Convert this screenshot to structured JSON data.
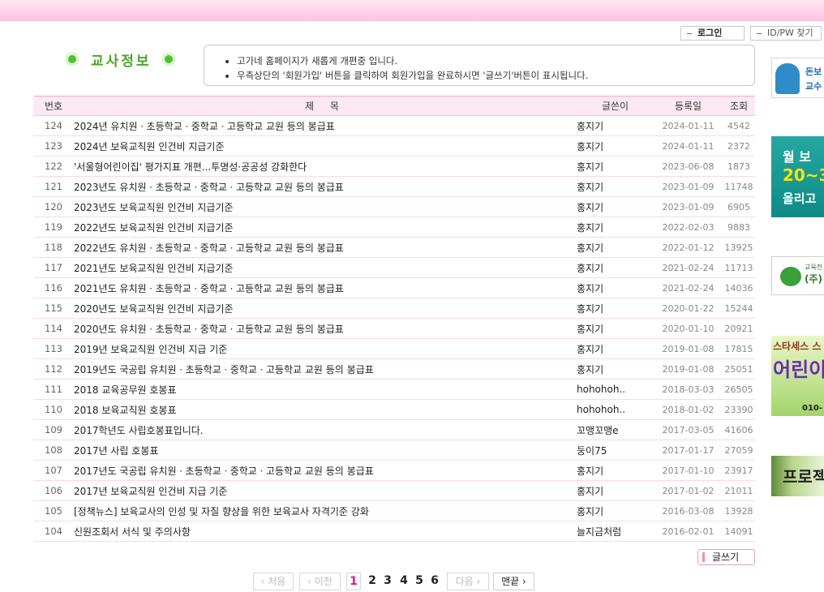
{
  "header": {
    "login_label": "로그인",
    "idpw_label": "ID/PW 찾기"
  },
  "section": {
    "title": "교사정보"
  },
  "notice": {
    "lines": [
      "고가네 홈페이지가 새롭게 개편중 입니다.",
      "우측상단의 '회원가입' 버튼을 클릭하여 회원가입을 완료하시면 '글쓰기'버튼이 표시됩니다."
    ]
  },
  "board": {
    "columns": [
      "번호",
      "제 목",
      "글쓴이",
      "등록일",
      "조회"
    ],
    "rows": [
      {
        "no": "124",
        "title": "2024년 유치원ㆍ초등학교ㆍ중학교ㆍ고등학교 교원 등의 봉급표",
        "author": "홍지기",
        "date": "2024-01-11",
        "views": "4542"
      },
      {
        "no": "123",
        "title": "2024년 보육교직원 인건비 지급기준",
        "author": "홍지기",
        "date": "2024-01-11",
        "views": "2372"
      },
      {
        "no": "122",
        "title": "'서울형어린이집' 평가지표 개편...투명성·공공성 강화한다",
        "author": "홍지기",
        "date": "2023-06-08",
        "views": "1873"
      },
      {
        "no": "121",
        "title": "2023년도 유치원ㆍ초등학교ㆍ중학교ㆍ고등학교 교원 등의 봉급표",
        "author": "홍지기",
        "date": "2023-01-09",
        "views": "11748"
      },
      {
        "no": "120",
        "title": "2023년도 보육교직원 인건비 지급기준",
        "author": "홍지기",
        "date": "2023-01-09",
        "views": "6905"
      },
      {
        "no": "119",
        "title": "2022년도 보육교직원 인건비 지급기준",
        "author": "홍지기",
        "date": "2022-02-03",
        "views": "9883"
      },
      {
        "no": "118",
        "title": "2022년도 유치원ㆍ초등학교ㆍ중학교ㆍ고등학교 교원 등의 봉급표",
        "author": "홍지기",
        "date": "2022-01-12",
        "views": "13925"
      },
      {
        "no": "117",
        "title": "2021년도 보육교직원 인건비 지급기준",
        "author": "홍지기",
        "date": "2021-02-24",
        "views": "11713"
      },
      {
        "no": "116",
        "title": "2021년도 유치원ㆍ초등학교ㆍ중학교ㆍ고등학교 교원 등의 봉급표",
        "author": "홍지기",
        "date": "2021-02-24",
        "views": "14036"
      },
      {
        "no": "115",
        "title": "2020년도 보육교직원 인건비 지급기준",
        "author": "홍지기",
        "date": "2020-01-22",
        "views": "15244"
      },
      {
        "no": "114",
        "title": "2020년도 유치원ㆍ초등학교ㆍ중학교ㆍ고등학교 교원 등의 봉급표",
        "author": "홍지기",
        "date": "2020-01-10",
        "views": "20921"
      },
      {
        "no": "113",
        "title": "2019년 보육교직원 인건비 지급 기준",
        "author": "홍지기",
        "date": "2019-01-08",
        "views": "17815"
      },
      {
        "no": "112",
        "title": "2019년도 국공립 유치원ㆍ초등학교ㆍ중학교ㆍ고등학교 교원 등의 봉급표",
        "author": "홍지기",
        "date": "2019-01-08",
        "views": "25051"
      },
      {
        "no": "111",
        "title": "2018 교육공무원 호봉표",
        "author": "hohohoh..",
        "date": "2018-03-03",
        "views": "26505"
      },
      {
        "no": "110",
        "title": "2018 보육교직원 호봉표",
        "author": "hohohoh..",
        "date": "2018-01-02",
        "views": "23390"
      },
      {
        "no": "109",
        "title": "2017학년도 사립호봉표입니다.",
        "author": "꼬맹꼬맹e",
        "date": "2017-03-05",
        "views": "41606"
      },
      {
        "no": "108",
        "title": "2017년 사립 호봉표",
        "author": "둥이75",
        "date": "2017-01-17",
        "views": "27059"
      },
      {
        "no": "107",
        "title": "2017년도 국공립 유치원ㆍ초등학교ㆍ중학교ㆍ고등학교 교원 등의 봉급표",
        "author": "홍지기",
        "date": "2017-01-10",
        "views": "23917"
      },
      {
        "no": "106",
        "title": "2017년 보육교직원 인건비 지급 기준",
        "author": "홍지기",
        "date": "2017-01-02",
        "views": "21011"
      },
      {
        "no": "105",
        "title": "[정책뉴스] 보육교사의 인성 및 자질 향상을 위한 보육교사 자격기준 강화",
        "author": "홍지기",
        "date": "2016-03-08",
        "views": "13928"
      },
      {
        "no": "104",
        "title": "신원조회서 서식 및 주의사항",
        "author": "늘지금처럼",
        "date": "2016-02-01",
        "views": "14091"
      }
    ]
  },
  "write_label": "글쓰기",
  "pagination": {
    "first": "‹ 처음",
    "prev": "‹ 이전",
    "pages": [
      "1",
      "2",
      "3",
      "4",
      "5",
      "6"
    ],
    "current": "1",
    "next": "다음 ›",
    "last": "맨끝 ›"
  },
  "ads": {
    "ad1": [
      "돈보",
      "교수"
    ],
    "ad2": [
      "월 보",
      "20~3",
      "올리고"
    ],
    "ad3": [
      "교육전",
      "(주)ㄱ"
    ],
    "ad4": [
      "스타세스 스",
      "어린이",
      "010-"
    ],
    "ad5": "프로젝"
  },
  "colors": {
    "accent_pink": "#e5147e",
    "header_band": "#fdc2e2",
    "title_green": "#4aa626"
  }
}
